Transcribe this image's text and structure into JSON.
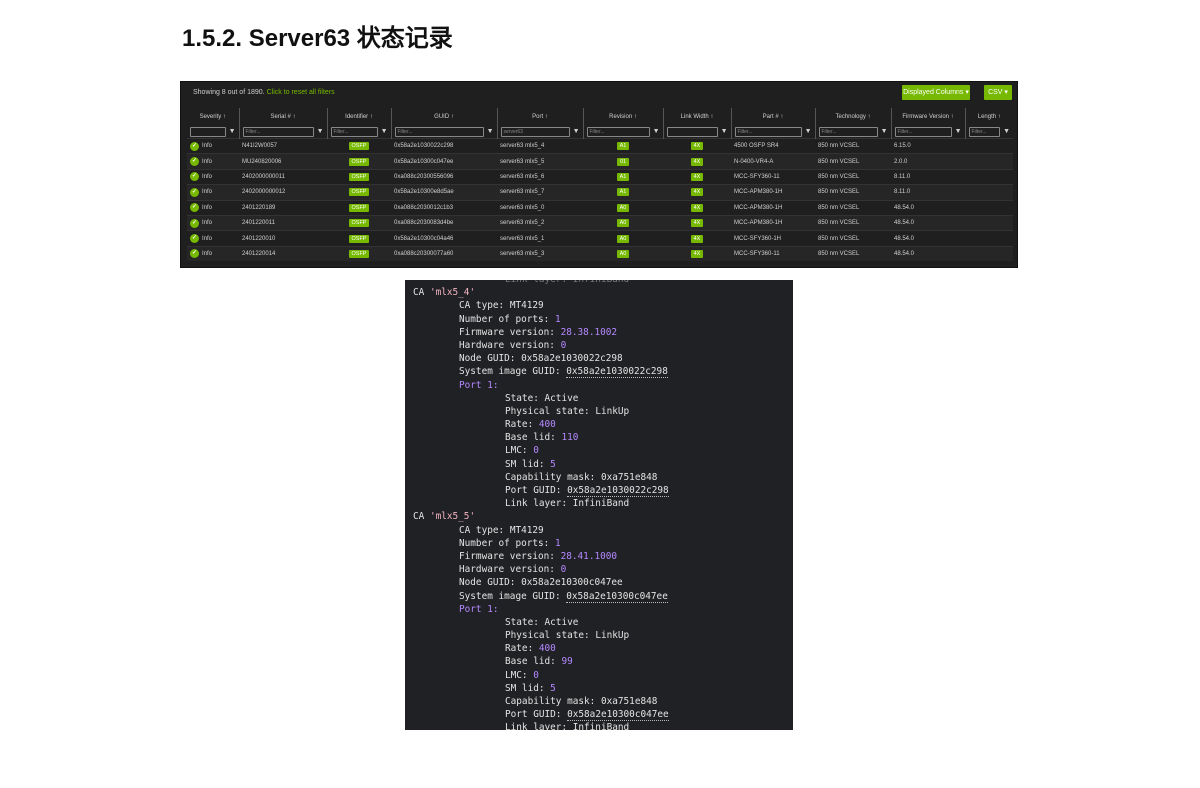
{
  "heading": "1.5.2. Server63 状态记录",
  "dashboard": {
    "showing_text": "Showing 8 out of 1890.",
    "reset_link": "Click to reset all filters",
    "displayed_columns_label": "Displayed Columns ▾",
    "csv_label": "CSV ▾",
    "columns": [
      "Severity ↑",
      "Serial # ↑",
      "Identifier ↑",
      "GUID ↑",
      "Port ↑",
      "Revision ↑",
      "Link Width ↑",
      "Part # ↑",
      "Technology ↑",
      "Firmware Version ↑",
      "Length ↑"
    ],
    "filters": [
      "",
      "Filter...",
      "Filter...",
      "Filter...",
      "server63",
      "Filter...",
      "",
      "Filter...",
      "Filter...",
      "Filter...",
      "Filter..."
    ],
    "rows": [
      {
        "severity": "Info",
        "serial": "N41I2W0057",
        "identifier": "OSFP",
        "guid": "0x58a2e1030022c298",
        "port": "server63 mlx5_4",
        "revision": "A1",
        "width": "4X",
        "part": "4500 OSFP SR4",
        "tech": "850 nm VCSEL",
        "fw": "6.15.0",
        "length": ""
      },
      {
        "severity": "Info",
        "serial": "MU240820006",
        "identifier": "OSFP",
        "guid": "0x58a2e10300c047ee",
        "port": "server63 mlx5_5",
        "revision": "01",
        "width": "4X",
        "part": "N-0400-VR4-A",
        "tech": "850 nm VCSEL",
        "fw": "2.0.0",
        "length": ""
      },
      {
        "severity": "Info",
        "serial": "2402000000011",
        "identifier": "OSFP",
        "guid": "0xa088c20300556096",
        "port": "server63 mlx5_6",
        "revision": "A1",
        "width": "4X",
        "part": "MCC-SFY360-11",
        "tech": "850 nm VCSEL",
        "fw": "8.11.0",
        "length": ""
      },
      {
        "severity": "Info",
        "serial": "2402000000012",
        "identifier": "OSFP",
        "guid": "0x58a2e10300e8d5ae",
        "port": "server63 mlx5_7",
        "revision": "A1",
        "width": "4X",
        "part": "MCC-APM380-1H",
        "tech": "850 nm VCSEL",
        "fw": "8.11.0",
        "length": ""
      },
      {
        "severity": "Info",
        "serial": "2401220189",
        "identifier": "OSFP",
        "guid": "0xa088c2030012c1b3",
        "port": "server63 mlx5_0",
        "revision": "A0",
        "width": "4X",
        "part": "MCC-APM380-1H",
        "tech": "850 nm VCSEL",
        "fw": "48.54.0",
        "length": ""
      },
      {
        "severity": "Info",
        "serial": "2401220011",
        "identifier": "OSFP",
        "guid": "0xa088c2030083d4be",
        "port": "server63 mlx5_2",
        "revision": "A0",
        "width": "4X",
        "part": "MCC-APM380-1H",
        "tech": "850 nm VCSEL",
        "fw": "48.54.0",
        "length": ""
      },
      {
        "severity": "Info",
        "serial": "2401220010",
        "identifier": "OSFP",
        "guid": "0x58a2e10300c04a46",
        "port": "server63 mlx5_1",
        "revision": "A0",
        "width": "4X",
        "part": "MCC-SFY360-1H",
        "tech": "850 nm VCSEL",
        "fw": "48.54.0",
        "length": ""
      },
      {
        "severity": "Info",
        "serial": "2401220014",
        "identifier": "OSFP",
        "guid": "0xa088c20300077a60",
        "port": "server63 mlx5_3",
        "revision": "A0",
        "width": "4X",
        "part": "MCC-SFY360-11",
        "tech": "850 nm VCSEL",
        "fw": "48.54.0",
        "length": ""
      }
    ]
  },
  "terminal": {
    "top_cut": "Link layer: InfiniBand",
    "blocks": [
      {
        "ca_prefix": "CA ",
        "ca_name": "'mlx5_4'",
        "ca_type_label": "CA type: ",
        "ca_type": "MT4129",
        "ports_label": "Number of ports: ",
        "ports": "1",
        "fw_label": "Firmware version: ",
        "fw": "28.38.1002",
        "hw_label": "Hardware version: ",
        "hw": "0",
        "node_guid_label": "Node GUID: ",
        "node_guid": "0x58a2e1030022c298",
        "sys_guid_label": "System image GUID: ",
        "sys_guid": "0x58a2e1030022c298",
        "port_label": "Port 1:",
        "state_label": "State: ",
        "state": "Active",
        "phys_label": "Physical state: ",
        "phys": "LinkUp",
        "rate_label": "Rate: ",
        "rate": "400",
        "lid_label": "Base lid: ",
        "lid": "110",
        "lmc_label": "LMC: ",
        "lmc": "0",
        "sm_label": "SM lid: ",
        "sm": "5",
        "cap_label": "Capability mask: ",
        "cap": "0xa751e848",
        "pguid_label": "Port GUID: ",
        "pguid": "0x58a2e1030022c298",
        "layer_label": "Link layer: ",
        "layer": "InfiniBand"
      },
      {
        "ca_prefix": "CA ",
        "ca_name": "'mlx5_5'",
        "ca_type_label": "CA type: ",
        "ca_type": "MT4129",
        "ports_label": "Number of ports: ",
        "ports": "1",
        "fw_label": "Firmware version: ",
        "fw": "28.41.1000",
        "hw_label": "Hardware version: ",
        "hw": "0",
        "node_guid_label": "Node GUID: ",
        "node_guid": "0x58a2e10300c047ee",
        "sys_guid_label": "System image GUID: ",
        "sys_guid": "0x58a2e10300c047ee",
        "port_label": "Port 1:",
        "state_label": "State: ",
        "state": "Active",
        "phys_label": "Physical state: ",
        "phys": "LinkUp",
        "rate_label": "Rate: ",
        "rate": "400",
        "lid_label": "Base lid: ",
        "lid": "99",
        "lmc_label": "LMC: ",
        "lmc": "0",
        "sm_label": "SM lid: ",
        "sm": "5",
        "cap_label": "Capability mask: ",
        "cap": "0xa751e848",
        "pguid_label": "Port GUID: ",
        "pguid": "0x58a2e10300c047ee",
        "layer_label": "Link layer: ",
        "layer": "InfiniBand"
      }
    ]
  },
  "colors": {
    "accent": "#76b900",
    "panel_bg": "#1f1f1f",
    "terminal_bg": "#202124",
    "terminal_number": "#b388ff",
    "terminal_string": "#f4b6c2"
  }
}
